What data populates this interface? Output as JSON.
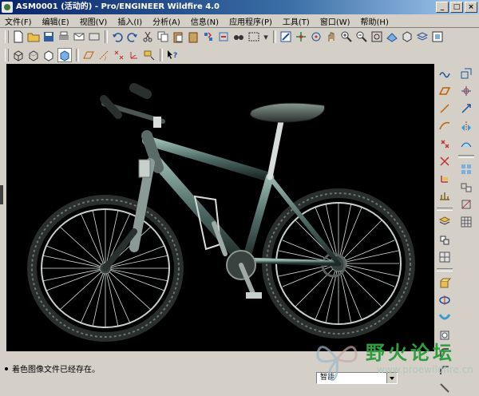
{
  "window": {
    "title": "ASM0001 (活动的) - Pro/ENGINEER Wildfire 4.0"
  },
  "menu": [
    "文件(F)",
    "编辑(E)",
    "视图(V)",
    "插入(I)",
    "分析(A)",
    "信息(N)",
    "应用程序(P)",
    "工具(T)",
    "窗口(W)",
    "帮助(H)"
  ],
  "status": {
    "message": "着色图像文件已经存在。",
    "filter_value": "智能"
  },
  "watermark": {
    "text": "野火论坛",
    "url": "www.proewildfire.cn"
  },
  "colors": {
    "viewport_bg": "#000000",
    "chrome": "#d4d0c8",
    "title_start": "#0a246a",
    "watermark_green": "#2e9e3e"
  }
}
